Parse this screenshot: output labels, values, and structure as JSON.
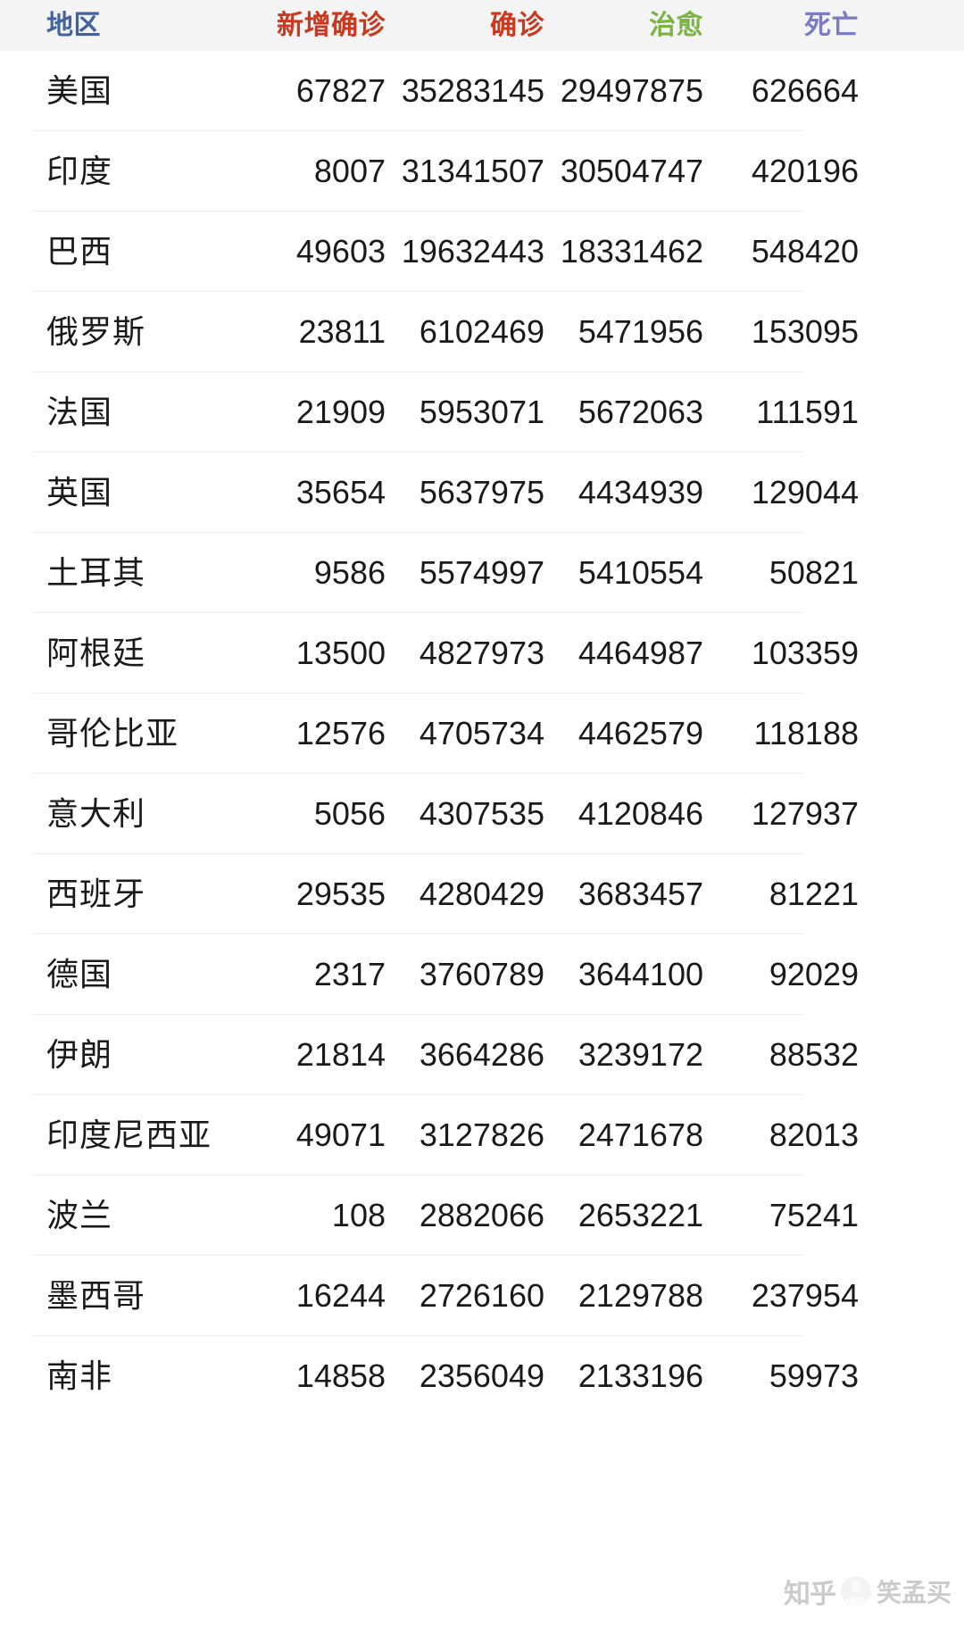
{
  "table": {
    "columns": [
      {
        "key": "region",
        "label": "地区",
        "color": "#4063a0",
        "align": "left"
      },
      {
        "key": "new",
        "label": "新增确诊",
        "color": "#c9381f",
        "align": "right"
      },
      {
        "key": "conf",
        "label": "确诊",
        "color": "#c9381f",
        "align": "right"
      },
      {
        "key": "cured",
        "label": "治愈",
        "color": "#7cb342",
        "align": "right"
      },
      {
        "key": "death",
        "label": "死亡",
        "color": "#7c7cc4",
        "align": "right"
      }
    ],
    "rows": [
      {
        "region": "美国",
        "new": "67827",
        "conf": "35283145",
        "cured": "29497875",
        "death": "626664"
      },
      {
        "region": "印度",
        "new": "8007",
        "conf": "31341507",
        "cured": "30504747",
        "death": "420196"
      },
      {
        "region": "巴西",
        "new": "49603",
        "conf": "19632443",
        "cured": "18331462",
        "death": "548420"
      },
      {
        "region": "俄罗斯",
        "new": "23811",
        "conf": "6102469",
        "cured": "5471956",
        "death": "153095"
      },
      {
        "region": "法国",
        "new": "21909",
        "conf": "5953071",
        "cured": "5672063",
        "death": "111591"
      },
      {
        "region": "英国",
        "new": "35654",
        "conf": "5637975",
        "cured": "4434939",
        "death": "129044"
      },
      {
        "region": "土耳其",
        "new": "9586",
        "conf": "5574997",
        "cured": "5410554",
        "death": "50821"
      },
      {
        "region": "阿根廷",
        "new": "13500",
        "conf": "4827973",
        "cured": "4464987",
        "death": "103359"
      },
      {
        "region": "哥伦比亚",
        "new": "12576",
        "conf": "4705734",
        "cured": "4462579",
        "death": "118188"
      },
      {
        "region": "意大利",
        "new": "5056",
        "conf": "4307535",
        "cured": "4120846",
        "death": "127937"
      },
      {
        "region": "西班牙",
        "new": "29535",
        "conf": "4280429",
        "cured": "3683457",
        "death": "81221"
      },
      {
        "region": "德国",
        "new": "2317",
        "conf": "3760789",
        "cured": "3644100",
        "death": "92029"
      },
      {
        "region": "伊朗",
        "new": "21814",
        "conf": "3664286",
        "cured": "3239172",
        "death": "88532"
      },
      {
        "region": "印度尼西亚",
        "new": "49071",
        "conf": "3127826",
        "cured": "2471678",
        "death": "82013"
      },
      {
        "region": "波兰",
        "new": "108",
        "conf": "2882066",
        "cured": "2653221",
        "death": "75241"
      },
      {
        "region": "墨西哥",
        "new": "16244",
        "conf": "2726160",
        "cured": "2129788",
        "death": "237954"
      },
      {
        "region": "南非",
        "new": "14858",
        "conf": "2356049",
        "cured": "2133196",
        "death": "59973"
      }
    ]
  },
  "watermark": {
    "logo": "知乎",
    "name": "笑孟买"
  }
}
